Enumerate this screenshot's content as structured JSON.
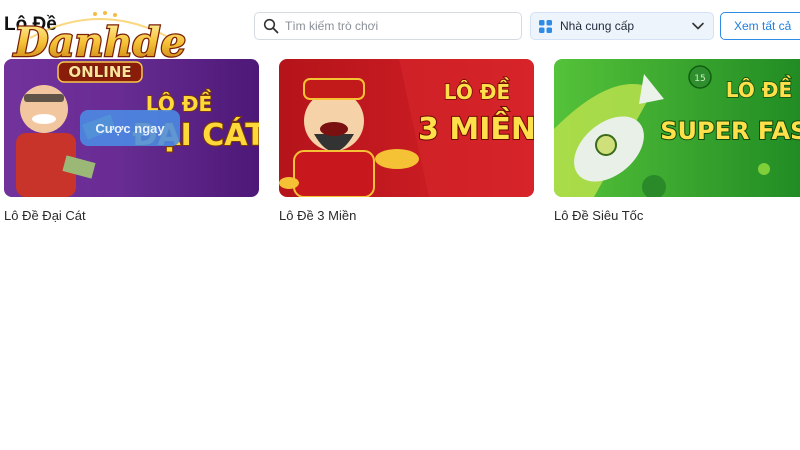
{
  "section": {
    "title": "Lô Đề"
  },
  "logo": {
    "line1": "Danhde",
    "line2": "ONLINE"
  },
  "search": {
    "placeholder": "Tìm kiếm trò chơi",
    "icon": "search-icon"
  },
  "provider": {
    "label": "Nhà cung cấp",
    "icon": "grid-icon"
  },
  "view_all": {
    "label": "Xem tất cả"
  },
  "games": [
    {
      "title": "Lô Đề Đại Cát",
      "banner_line1": "LÔ ĐỀ",
      "banner_line2": "ĐẠI CÁT",
      "hover_button": "Cược ngay"
    },
    {
      "title": "Lô Đề 3 Miền",
      "banner_line1": "LÔ ĐỀ",
      "banner_line2": "3 MIỀN"
    },
    {
      "title": "Lô Đề Siêu Tốc",
      "banner_line1": "LÔ ĐỀ",
      "banner_line2": "SUPER FAST",
      "ball_number": "15"
    }
  ],
  "colors": {
    "accent": "#1f7fe0",
    "card1": "#5b1d8c",
    "card2": "#c8171d",
    "card3": "#2a9a2a"
  }
}
